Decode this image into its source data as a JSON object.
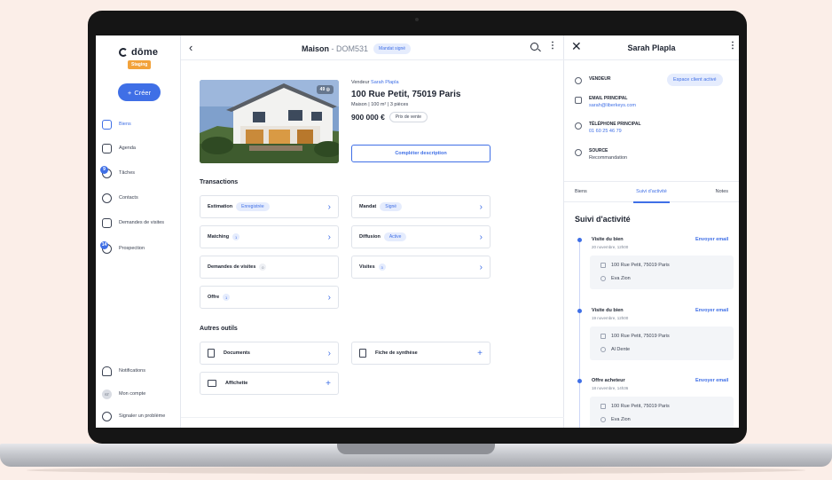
{
  "sidebar": {
    "logo_text": "dōme",
    "staging_label": "Staging",
    "create_label": "Créer",
    "items": [
      {
        "label": "Biens",
        "badge": ""
      },
      {
        "label": "Agenda",
        "badge": ""
      },
      {
        "label": "Tâches",
        "badge": "9"
      },
      {
        "label": "Contacts",
        "badge": ""
      },
      {
        "label": "Demandes de visites",
        "badge": ""
      },
      {
        "label": "Prospection",
        "badge": "14"
      }
    ],
    "bottom": [
      {
        "label": "Notifications"
      },
      {
        "label": "Mon compte",
        "avatar": "ST"
      },
      {
        "label": "Signaler un problème"
      }
    ]
  },
  "header": {
    "title": "Maison",
    "separator": " - ",
    "ref": "DOM531",
    "status": "Mandat signé"
  },
  "property": {
    "photo_count": "49",
    "seller_prefix": "Vendeur",
    "seller_name": "Sarah Plapla",
    "address": "100 Rue Petit, 75019 Paris",
    "specs": "Maison  |  100 m²  |  3 pièces",
    "price": "900 000 €",
    "price_label": "Prix de vente",
    "complete_label": "Compléter description"
  },
  "transactions": {
    "title": "Transactions",
    "cards": [
      {
        "label": "Estimation",
        "chip": "Enregistrée"
      },
      {
        "label": "Mandat",
        "chip": "Signé"
      },
      {
        "label": "Matching",
        "num": "1"
      },
      {
        "label": "Diffusion",
        "chip": "Active"
      },
      {
        "label": "Demandes de visites",
        "num": "0"
      },
      {
        "label": "Visites",
        "num": "3"
      },
      {
        "label": "Offre",
        "num": "1"
      }
    ]
  },
  "tools": {
    "title": "Autres outils",
    "cards": [
      {
        "label": "Documents"
      },
      {
        "label": "Fiche de synthèse"
      },
      {
        "label": "Affichette"
      }
    ]
  },
  "contact": {
    "name": "Sarah Plapla",
    "role_label": "VENDEUR",
    "espace_label": "Espace client activé",
    "email_label": "EMAIL PRINCIPAL",
    "email": "sarah@liberkeys.com",
    "phone_label": "TÉLÉPHONE PRINCIPAL",
    "phone": "01 60 25 46 79",
    "source_label": "SOURCE",
    "source": "Recommandation",
    "tabs": [
      "Biens",
      "Suivi d'activité",
      "Notes"
    ],
    "activity_title": "Suivi d'activité",
    "send_email_label": "Envoyer email",
    "events": [
      {
        "title": "Visite du bien",
        "date": "20 novembre, 12h00",
        "address": "100 Rue Petit, 75019 Paris",
        "person": "Eva Zion"
      },
      {
        "title": "Visite du bien",
        "date": "19 novembre, 12h00",
        "address": "100 Rue Petit, 75019 Paris",
        "person": "Al Dente"
      },
      {
        "title": "Offre acheteur",
        "date": "18 novembre, 14h36",
        "address": "100 Rue Petit, 75019 Paris",
        "person": "Eva Zion"
      }
    ]
  },
  "colors": {
    "accent": "#3f6fe6",
    "staging": "#f2a23b",
    "background": "#fbeee8"
  }
}
